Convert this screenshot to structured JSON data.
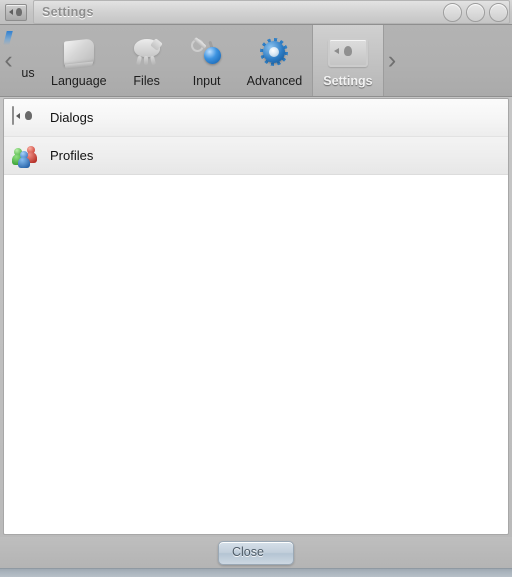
{
  "window": {
    "title": "Settings",
    "title_icon": "dialog-icon",
    "controls": [
      {
        "name": "minimize-button",
        "glyph": "circle"
      },
      {
        "name": "maximize-button",
        "glyph": "circle"
      },
      {
        "name": "close-window-button",
        "glyph": "circle"
      }
    ]
  },
  "toolbar": {
    "scroll_left": "‹",
    "scroll_right": "›",
    "tabs": [
      {
        "label": "us",
        "icon": "cut-off-tab-icon",
        "active": false,
        "cut": true
      },
      {
        "label": "Language",
        "icon": "book-icon",
        "active": false
      },
      {
        "label": "Files",
        "icon": "files-icon",
        "active": false
      },
      {
        "label": "Input",
        "icon": "key-sphere-icon",
        "active": false
      },
      {
        "label": "Advanced",
        "icon": "gear-icon",
        "active": false
      },
      {
        "label": "Settings",
        "icon": "monitor-icon",
        "active": true
      }
    ]
  },
  "content": {
    "rows": [
      {
        "label": "Dialogs",
        "icon": "dialog-box-icon"
      },
      {
        "label": "Profiles",
        "icon": "people-icon"
      }
    ]
  },
  "footer": {
    "close_label": "Close"
  },
  "colors": {
    "accent_blue": "#2f7fc6",
    "toolbar_gray": "#b0b0b0",
    "titlebar_gray": "#c6c6c6",
    "content_white": "#ffffff",
    "button_blue_gray": "#c2cfdb"
  }
}
